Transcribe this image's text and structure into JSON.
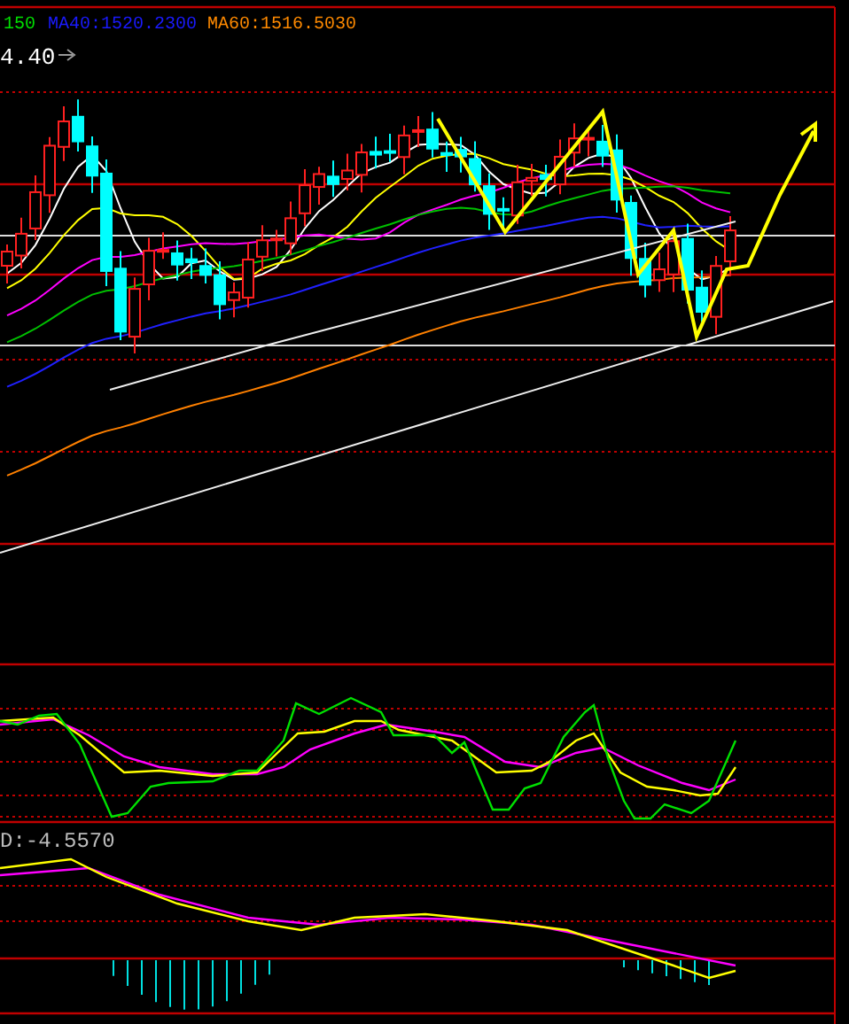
{
  "legend": [
    {
      "text": "150",
      "color": "#00e000"
    },
    {
      "text": "MA40:1520.2300",
      "color": "#1a1aff"
    },
    {
      "text": "MA60:1516.5030",
      "color": "#ff8a00"
    }
  ],
  "price_label": "4.40",
  "macd_label": "D:-4.5570"
}
